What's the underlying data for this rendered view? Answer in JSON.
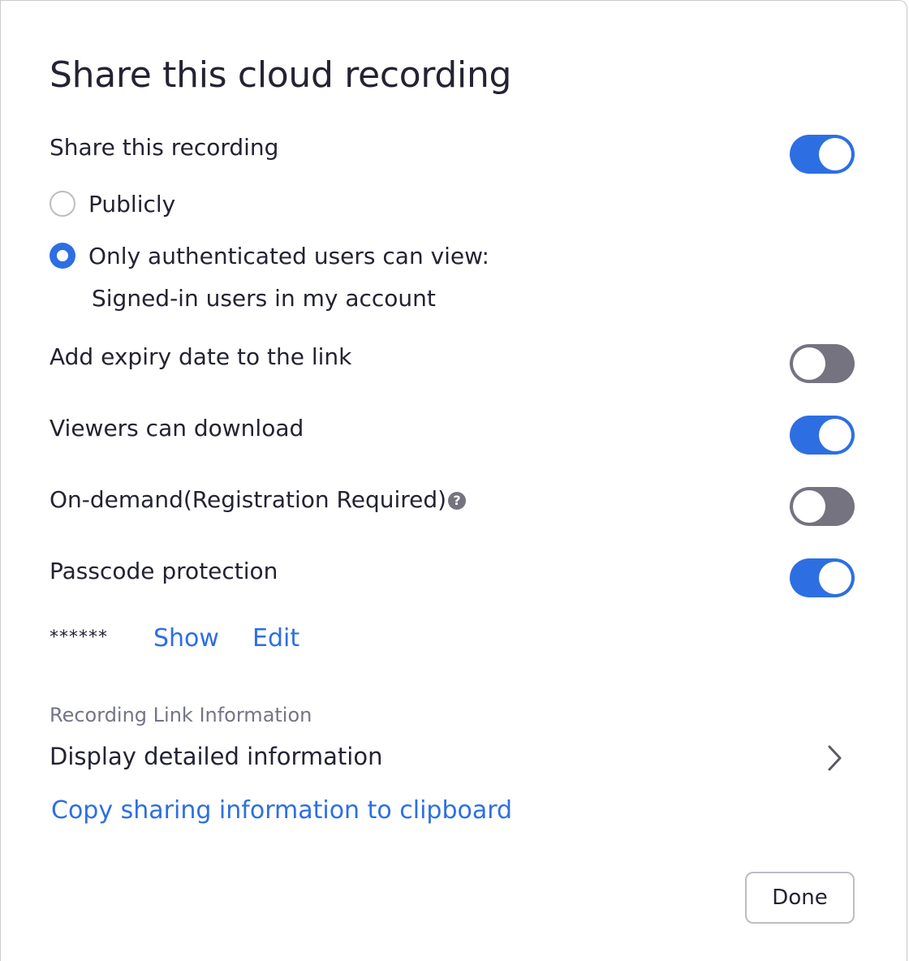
{
  "dialog": {
    "title": "Share this cloud recording"
  },
  "share_recording": {
    "label": "Share this recording",
    "enabled": true
  },
  "visibility": {
    "options": [
      {
        "label": "Publicly",
        "selected": false
      },
      {
        "label": "Only authenticated users can view:",
        "selected": true
      }
    ],
    "auth_scope": "Signed-in users in my account"
  },
  "expiry": {
    "label": "Add expiry date to the link",
    "enabled": false
  },
  "download": {
    "label": "Viewers can download",
    "enabled": true
  },
  "on_demand": {
    "label": "On-demand(Registration Required)",
    "enabled": false,
    "help_glyph": "?"
  },
  "passcode": {
    "label": "Passcode protection",
    "enabled": true,
    "masked_value": "******",
    "show_label": "Show",
    "edit_label": "Edit"
  },
  "link_info": {
    "section_label": "Recording Link Information",
    "details_label": "Display detailed information",
    "copy_label": "Copy sharing information to clipboard"
  },
  "footer": {
    "done_label": "Done"
  },
  "colors": {
    "accent": "#2d6fe2",
    "toggle_off": "#74737f",
    "text": "#232333",
    "muted": "#747487"
  }
}
